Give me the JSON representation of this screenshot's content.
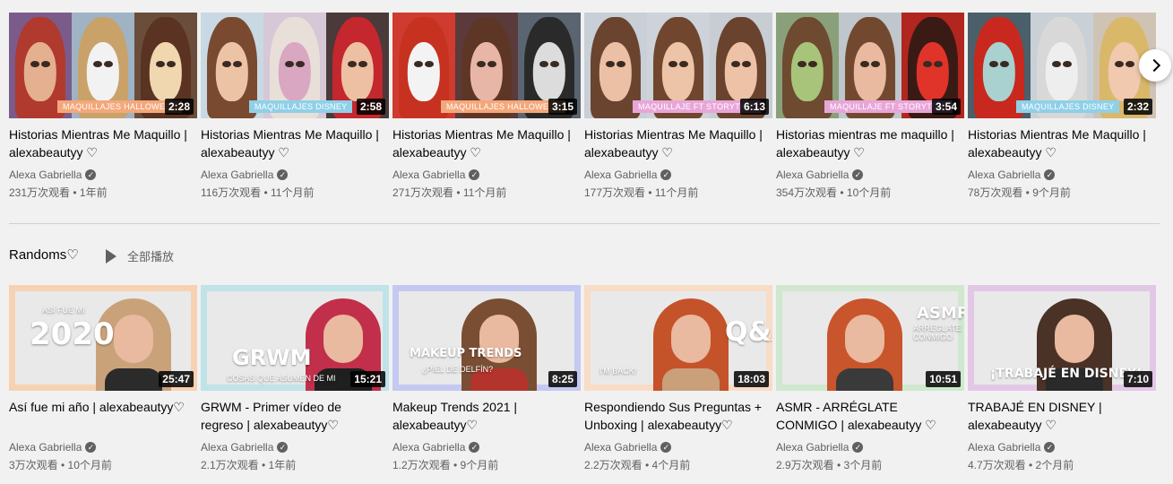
{
  "shelf1": {
    "videos": [
      {
        "title": "Historias Mientras Me Maquillo | alexabeautyy ♡",
        "channel": "Alexa Gabriella",
        "meta": "231万次观看 • 1年前",
        "duration": "2:28",
        "tag": "MAQUILLAJES HALLOWEEN",
        "tag_color": "#f4a77a",
        "panels": [
          "#7b5b8a",
          "#9fb3c4",
          "#6a4d3a"
        ],
        "hair": [
          "#b03a2e",
          "#c9a26a",
          "#5a3322"
        ],
        "faces": [
          "#e5b08f",
          "#f2f2f2",
          "#f0d7b0"
        ]
      },
      {
        "title": "Historias Mientras Me Maquillo | alexabeautyy ♡",
        "channel": "Alexa Gabriella",
        "meta": "116万次观看 • 11个月前",
        "duration": "2:58",
        "tag": "MAQUILLAJES DISNEY",
        "tag_color": "#8fd0e8",
        "panels": [
          "#c9d9e3",
          "#d6c8d7",
          "#4b3a3a"
        ],
        "hair": [
          "#7a4a30",
          "#e8e0d8",
          "#c4272d"
        ],
        "faces": [
          "#edc3a6",
          "#d9a7c2",
          "#eec0a3"
        ]
      },
      {
        "title": "Historias Mientras Me Maquillo | alexabeautyy ♡",
        "channel": "Alexa Gabriella",
        "meta": "271万次观看 • 11个月前",
        "duration": "3:15",
        "tag": "MAQUILLAJES HALLOWEEN",
        "tag_color": "#f4a77a",
        "panels": [
          "#cf3b2f",
          "#5a3a3a",
          "#5b6571"
        ],
        "hair": [
          "#c6321f",
          "#5e3626",
          "#2a2a2a"
        ],
        "faces": [
          "#f3f3f3",
          "#e8b6a6",
          "#dcdcdc"
        ]
      },
      {
        "title": "Historias Mientras Me Maquillo | alexabeautyy ♡",
        "channel": "Alexa Gabriella",
        "meta": "177万次观看 • 11个月前",
        "duration": "6:13",
        "tag": "MAQUILLAJE FT STORYTIME",
        "tag_color": "#e8a6d8",
        "panels": [
          "#c8cfd6",
          "#cdd3d8",
          "#c7cdd3"
        ],
        "hair": [
          "#6b4430",
          "#70462f",
          "#6a432e"
        ],
        "faces": [
          "#ecc0a4",
          "#eec4a8",
          "#edc2a6"
        ]
      },
      {
        "title": "Historias mientras me maquillo | alexabeautyy ♡",
        "channel": "Alexa Gabriella",
        "meta": "354万次观看 • 10个月前",
        "duration": "3:54",
        "tag": "MAQUILLAJE FT STORYTIME",
        "tag_color": "#e8a6d8",
        "panels": [
          "#8aa07a",
          "#bfc6cc",
          "#b1261e"
        ],
        "hair": [
          "#6e4a30",
          "#72492f",
          "#3a1a14"
        ],
        "faces": [
          "#a8c47a",
          "#e9b9a0",
          "#e0332a"
        ]
      },
      {
        "title": "Historias Mientras Me Maquillo | alexabeautyy ♡",
        "channel": "Alexa Gabriella",
        "meta": "78万次观看 • 9个月前",
        "duration": "2:32",
        "tag": "MAQUILLAJES DISNEY",
        "tag_color": "#8fd0e8",
        "panels": [
          "#4a5f6a",
          "#c9d0d6",
          "#cfc3b4"
        ],
        "hair": [
          "#c9281e",
          "#d8d8d8",
          "#d9b86a"
        ],
        "faces": [
          "#a9d1cf",
          "#eeeeee",
          "#f0c9ae"
        ]
      }
    ]
  },
  "shelf2": {
    "title": "Randoms♡",
    "play_all": "全部播放",
    "videos": [
      {
        "title": "Así fue mi año | alexabeautyy♡",
        "channel": "Alexa Gabriella",
        "meta": "3万次观看 • 10个月前",
        "duration": "25:47",
        "border": "#f6d2b3",
        "big": "2020",
        "small": "ASÍ FUE MI",
        "hair": "#caa27a",
        "body": "#2b2b2b"
      },
      {
        "title": "GRWM - Primer vídeo de regreso | alexabeautyy♡",
        "channel": "Alexa Gabriella",
        "meta": "2.1万次观看 • 1年前",
        "duration": "15:21",
        "border": "#bfe3e8",
        "big": "GRWM",
        "small": "COSAS QUE ASUMEN DE MI",
        "hair": "#c12f4a",
        "body": "#1f1f1f"
      },
      {
        "title": "Makeup Trends 2021 | alexabeautyy♡",
        "channel": "Alexa Gabriella",
        "meta": "1.2万次观看 • 9个月前",
        "duration": "8:25",
        "border": "#c4c9f2",
        "big": "MAKEUP TRENDS",
        "small": "¿PIEL DE DELFÍN?",
        "hair": "#7a4e33",
        "body": "#b3342c"
      },
      {
        "title": "Respondiendo Sus Preguntas + Unboxing | alexabeautyy♡",
        "channel": "Alexa Gabriella",
        "meta": "2.2万次观看 • 4个月前",
        "duration": "18:03",
        "border": "#f8dcc6",
        "big": "Q&A",
        "small": "I'M BACK!",
        "hair": "#c4532a",
        "body": "#caa07a"
      },
      {
        "title": "ASMR - ARRÉGLATE CONMIGO | alexabeautyy ♡",
        "channel": "Alexa Gabriella",
        "meta": "2.9万次观看 • 3个月前",
        "duration": "10:51",
        "border": "#cfe8cf",
        "big": "ASMR",
        "small": "ARRÉGLATE CONMIGO",
        "hair": "#c8552b",
        "body": "#3a3a3a"
      },
      {
        "title": "TRABAJÉ EN DISNEY | alexabeautyy ♡",
        "channel": "Alexa Gabriella",
        "meta": "4.7万次观看 • 2个月前",
        "duration": "7:10",
        "border": "#e2c8e6",
        "big": "¡TRABAJÉ EN DISNEY!",
        "small": "",
        "hair": "#4a3226",
        "body": "#2a2a2a"
      }
    ]
  }
}
